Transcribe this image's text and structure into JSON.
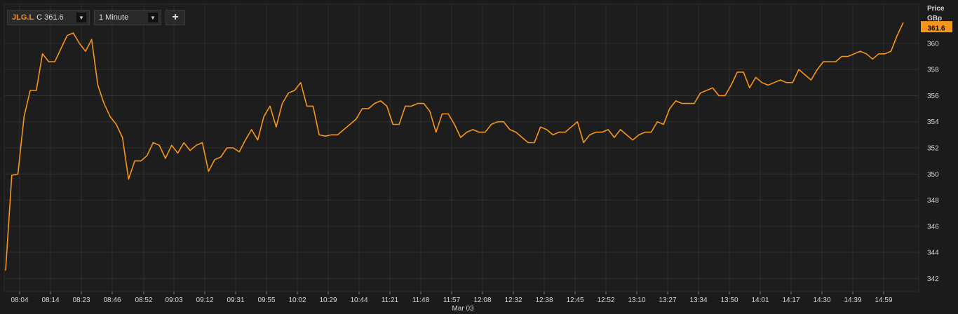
{
  "toolbar": {
    "symbol": "JLG.L",
    "close_prefix": "C",
    "close_value": "361.6",
    "interval": "1 Minute",
    "add_label": "+"
  },
  "colors": {
    "background": "#1b1b1b",
    "grid": "#303030",
    "line": "#f7941d",
    "label_bg": "#f7941d"
  },
  "chart_data": {
    "type": "line",
    "ylabel": "Price",
    "yunit": "GBp",
    "date_label": "Mar 03",
    "last_value_label": "361.6",
    "ylim": [
      341,
      363
    ],
    "yticks": [
      342,
      344,
      346,
      348,
      350,
      352,
      354,
      356,
      358,
      360
    ],
    "xticks": [
      "08:04",
      "08:14",
      "08:23",
      "08:46",
      "08:52",
      "09:03",
      "09:12",
      "09:31",
      "09:55",
      "10:02",
      "10:29",
      "10:44",
      "11:21",
      "11:48",
      "11:57",
      "12:08",
      "12:32",
      "12:38",
      "12:45",
      "12:52",
      "13:10",
      "13:27",
      "13:34",
      "13:50",
      "14:01",
      "14:17",
      "14:30",
      "14:39",
      "14:59"
    ],
    "grid": true,
    "series": [
      {
        "values": [
          342.6,
          349.9,
          350.0,
          354.4,
          356.4,
          356.4,
          359.2,
          358.6,
          358.6,
          359.6,
          360.6,
          360.8,
          360.0,
          359.4,
          360.3,
          356.8,
          355.4,
          354.4,
          353.8,
          352.8,
          349.6,
          351.0,
          351.0,
          351.4,
          352.4,
          352.2,
          351.2,
          352.2,
          351.6,
          352.4,
          351.8,
          352.2,
          352.4,
          350.2,
          351.1,
          351.3,
          352.0,
          352.0,
          351.7,
          352.6,
          353.4,
          352.6,
          354.4,
          355.2,
          353.6,
          355.4,
          356.2,
          356.4,
          357.0,
          355.2,
          355.2,
          353.0,
          352.9,
          353.0,
          353.0,
          353.4,
          353.8,
          354.2,
          355.0,
          355.0,
          355.4,
          355.6,
          355.2,
          353.8,
          353.8,
          355.2,
          355.2,
          355.4,
          355.4,
          354.8,
          353.2,
          354.6,
          354.6,
          353.8,
          352.8,
          353.2,
          353.4,
          353.2,
          353.2,
          353.8,
          354.0,
          354.0,
          353.4,
          353.2,
          352.8,
          352.4,
          352.4,
          353.6,
          353.4,
          353.0,
          353.2,
          353.2,
          353.6,
          354.0,
          352.4,
          353.0,
          353.2,
          353.2,
          353.4,
          352.8,
          353.4,
          353.0,
          352.6,
          353.0,
          353.2,
          353.2,
          354.0,
          353.8,
          355.0,
          355.6,
          355.4,
          355.4,
          355.4,
          356.2,
          356.4,
          356.6,
          356.0,
          356.0,
          356.8,
          357.8,
          357.8,
          356.6,
          357.4,
          357.0,
          356.8,
          357.0,
          357.2,
          357.0,
          357.0,
          358.0,
          357.6,
          357.2,
          358.0,
          358.6,
          358.6,
          358.6,
          359.0,
          359.0,
          359.2,
          359.4,
          359.2,
          358.8,
          359.2,
          359.2,
          359.4,
          360.6,
          361.6
        ]
      }
    ]
  }
}
